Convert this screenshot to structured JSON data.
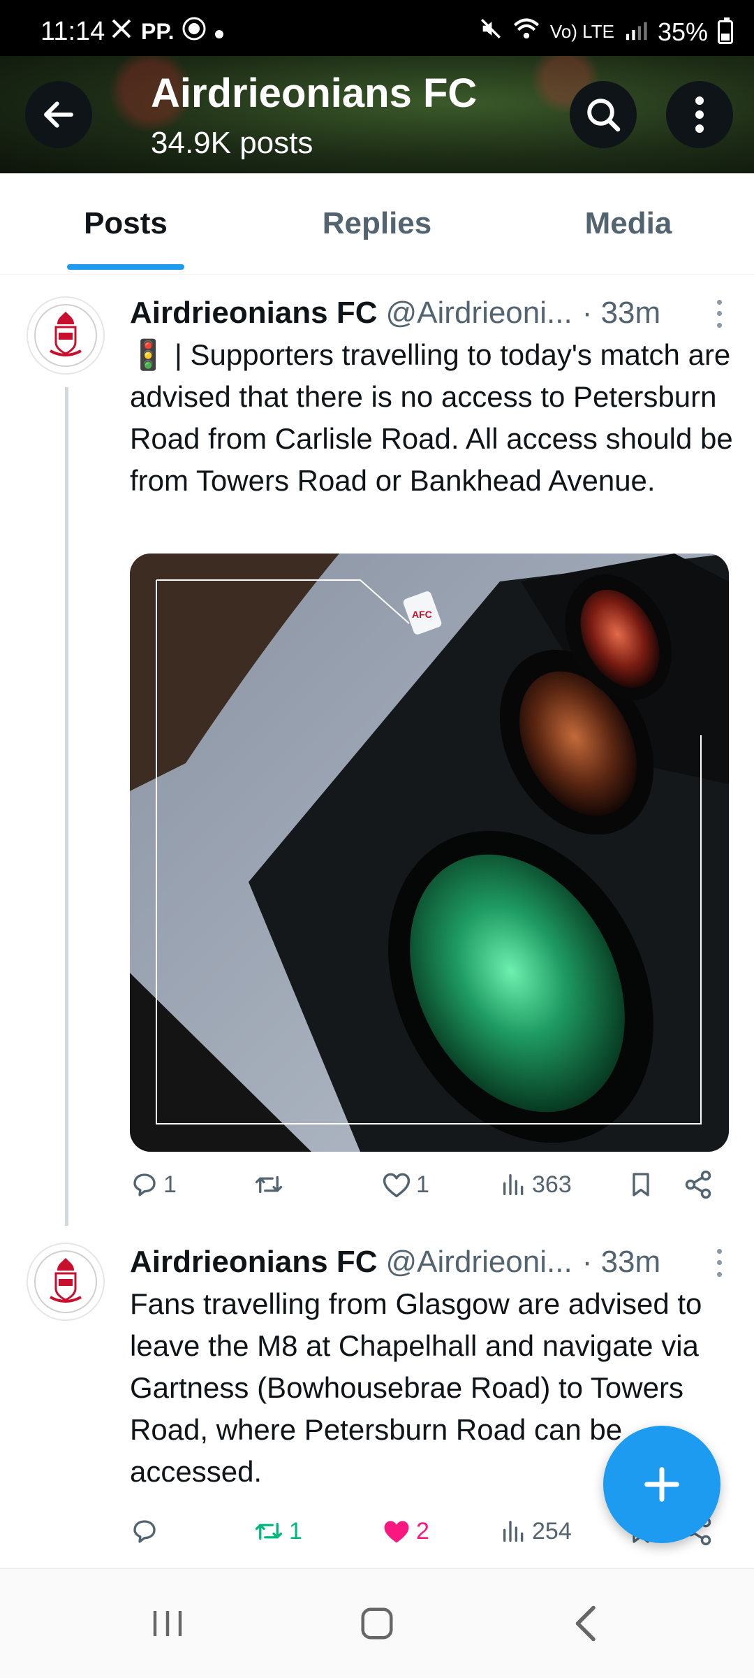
{
  "status_bar": {
    "time": "11:14",
    "left_icons": [
      "x-icon",
      "pp-icon",
      "nord-icon",
      "dot-icon"
    ],
    "pp_label": "PP.",
    "network_label": "Vo) LTE",
    "battery": "35%"
  },
  "header": {
    "title": "Airdrieonians FC",
    "subtitle": "34.9K posts"
  },
  "tabs": [
    {
      "label": "Posts",
      "active": true
    },
    {
      "label": "Replies",
      "active": false
    },
    {
      "label": "Media",
      "active": false
    }
  ],
  "posts": [
    {
      "author": "Airdrieonians FC",
      "handle": "@Airdrieoni...",
      "time": "· 33m",
      "text": "🚦 | Supporters travelling to today's match are advised that there is no access to Petersburn Road from Carlisle Road. All access should be from Towers Road or Bankhead Avenue.",
      "media_logo_text": "AFC",
      "replies": "1",
      "reposts": "",
      "likes": "1",
      "views": "363"
    },
    {
      "author": "Airdrieonians FC",
      "handle": "@Airdrieoni...",
      "time": "· 33m",
      "text": "Fans travelling from Glasgow are advised to leave the M8 at Chapelhall and navigate via Gartness (Bowhousebrae Road) to Towers Road, where Petersburn Road can be accessed.",
      "replies": "",
      "reposts": "1",
      "likes": "2",
      "views": "254"
    }
  ],
  "colors": {
    "accent": "#1d9bf0",
    "repost_active": "#00ba7c",
    "like_active": "#f91880",
    "muted": "#536471"
  }
}
